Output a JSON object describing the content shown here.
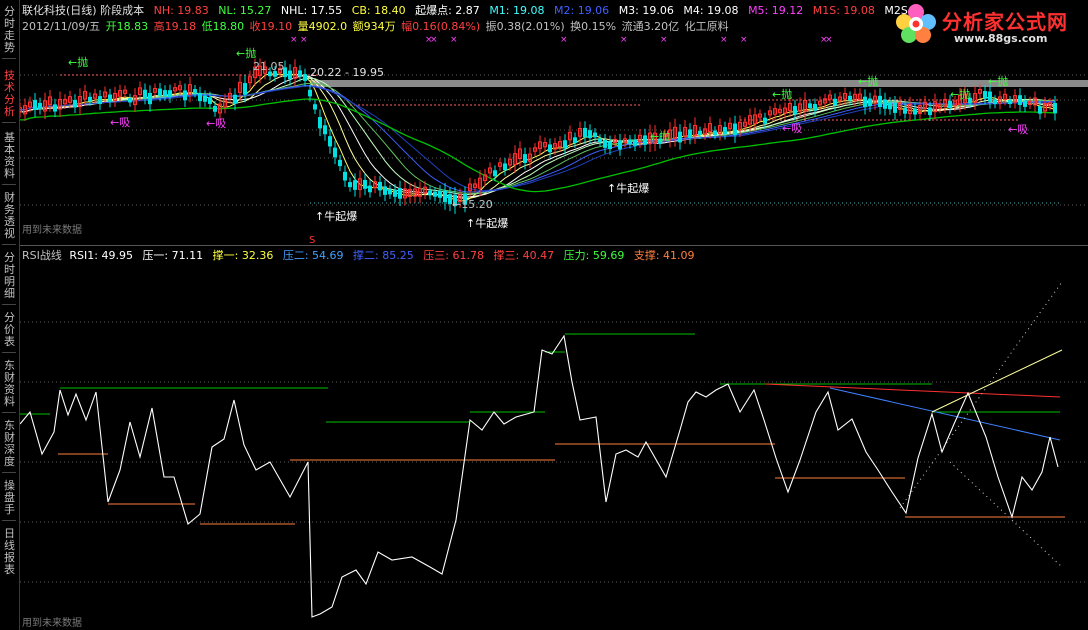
{
  "sidebar": {
    "tabs": [
      {
        "label": "分时走势",
        "active": false
      },
      {
        "label": "技术分析",
        "active": true
      },
      {
        "label": "基本资料",
        "active": false
      },
      {
        "label": "财务透视",
        "active": false
      },
      {
        "label": "分时明细",
        "active": false
      },
      {
        "label": "分价表",
        "active": false
      },
      {
        "label": "东财资料",
        "active": false
      },
      {
        "label": "东财深度",
        "active": false
      },
      {
        "label": "操盘手",
        "active": false
      },
      {
        "label": "日线报表",
        "active": false
      }
    ]
  },
  "header": {
    "title": "联化科技(日线) 阶段成本",
    "nh": "NH: 19.83",
    "nl": "NL: 15.27",
    "nhl": "NHL: 17.55",
    "cb": "CB: 18.40",
    "qbd": "起爆点: 2.87",
    "m1": "M1: 19.08",
    "m2": "M2: 19.06",
    "m3": "M3: 19.06",
    "m4": "M4: 19.08",
    "m5": "M5: 19.12",
    "m1s": "M1S: 19.08",
    "m2s": "M2S",
    "date": "2012/11/09/五",
    "open": "开18.83",
    "high": "高19.18",
    "low": "低18.80",
    "close": "收19.10",
    "vol": "量4902.0",
    "amount": "额934万",
    "change": "幅0.16(0.84%)",
    "amp": "振0.38(2.01%)",
    "turnover": "换0.15%",
    "float": "流通3.20亿",
    "sector": "化工原料"
  },
  "price_chart": {
    "annotations": {
      "pao": "抛",
      "xi": "吸",
      "niu": "牛起爆",
      "range_label": "20.22 - 19.95",
      "high_mark": "21.05",
      "low_mark": "15.20",
      "s_mark": "S"
    },
    "footer": "用到未来数据"
  },
  "rsi_panel": {
    "name": "RSI战线",
    "rsi1": "RSI1: 49.95",
    "ya1": "压一: 71.11",
    "cheng1": "撑一: 32.36",
    "ya2": "压二: 54.69",
    "cheng2": "撑二: 85.25",
    "ya3": "压三: 61.78",
    "cheng3": "撑三: 40.47",
    "yali": "压力: 59.69",
    "zhicheng": "支撑: 41.09",
    "footer": "用到未来数据"
  },
  "logo": {
    "title": "分析家公式网",
    "url": "www.88gs.com"
  },
  "colors": {
    "up": "#ff3030",
    "down": "#00e0e0",
    "green": "#00d000",
    "yellow": "#ffff40",
    "magenta": "#ff40ff",
    "blue": "#4060ff",
    "orange": "#ff8040"
  }
}
